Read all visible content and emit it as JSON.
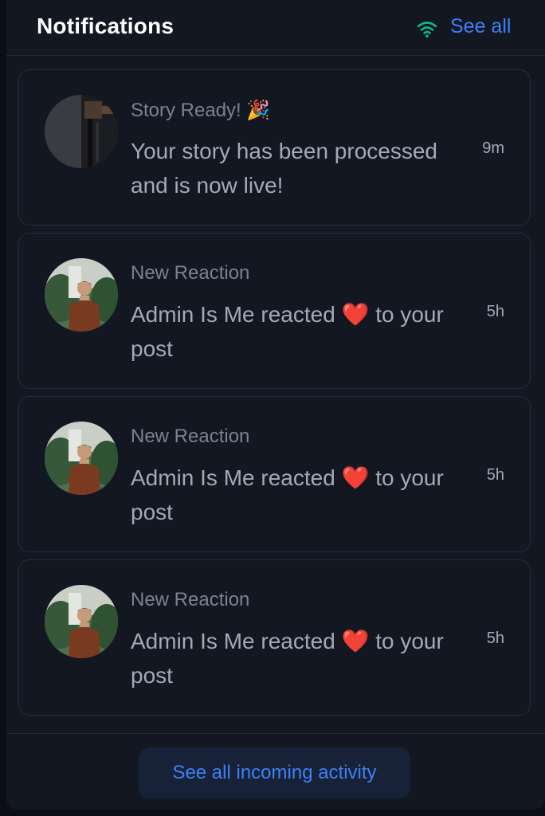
{
  "header": {
    "title": "Notifications",
    "see_all_label": "See all",
    "status_icon": "wifi-icon"
  },
  "notifications": [
    {
      "title": "Story Ready! 🎉",
      "message": "Your story has been processed and is now live!",
      "time": "9m",
      "avatar": "story-thumbnail"
    },
    {
      "title": "New Reaction",
      "message": "Admin Is Me reacted ❤️ to your post",
      "time": "5h",
      "avatar": "user-avatar"
    },
    {
      "title": "New Reaction",
      "message": "Admin Is Me reacted ❤️ to your post",
      "time": "5h",
      "avatar": "user-avatar"
    },
    {
      "title": "New Reaction",
      "message": "Admin Is Me reacted ❤️ to your post",
      "time": "5h",
      "avatar": "user-avatar"
    }
  ],
  "footer": {
    "button_label": "See all incoming activity"
  },
  "colors": {
    "panel_bg": "#121722",
    "accent": "#3b82f6",
    "status_green": "#10b981",
    "title_text": "#ffffff",
    "muted_text": "#7b8190",
    "body_text": "#a3a9b5"
  }
}
